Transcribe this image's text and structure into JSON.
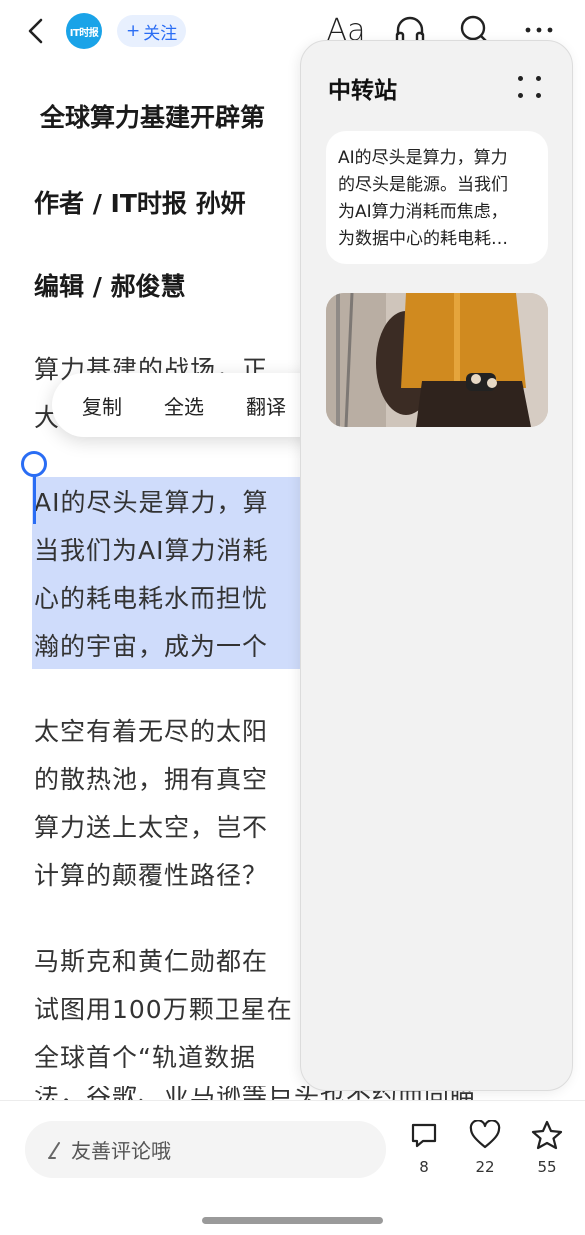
{
  "header": {
    "logo_text": "IT时报",
    "follow_label": "关注",
    "font_size_label": "Aa",
    "icons": [
      "back-icon",
      "headphones-icon",
      "search-icon",
      "more-icon"
    ]
  },
  "article": {
    "title": "全球算力基建开辟第",
    "author_line": "作者 /   IT时报  孙妍",
    "editor_line": "编辑 /   郝俊慧",
    "para1": [
      "算力基建的战场，正",
      "大"
    ],
    "para2_selected": [
      "AI的尽头是算力，算",
      "当我们为AI算力消耗",
      "心的耗电耗水而担忧",
      "瀚的宇宙，成为一个"
    ],
    "para3": [
      "太空有着无尽的太阳",
      "的散热池，拥有真空",
      "算力送上太空，岂不",
      "计算的颠覆性路径？"
    ],
    "para4": [
      "马斯克和黄仁勋都在",
      "试图用100万颗卫星在",
      "全球首个“轨道数据",
      "法，谷歌、亚马逊等巨头也不约而同瞄"
    ]
  },
  "context_menu": {
    "items": [
      "复制",
      "全选",
      "翻译"
    ]
  },
  "side_panel": {
    "title": "中转站",
    "text_card": [
      "AI的尽头是算力，算力",
      "的尽头是能源。当我们",
      "为AI算力消耗而焦虑，",
      "为数据中心的耗电耗…"
    ]
  },
  "bottom_bar": {
    "comment_placeholder": "友善评论哦",
    "comments_count": "8",
    "likes_count": "22",
    "favorites_count": "55"
  },
  "colors": {
    "accent": "#2a6df4",
    "selection": "#cfdcfb",
    "panel_bg": "#f2f2f2"
  }
}
